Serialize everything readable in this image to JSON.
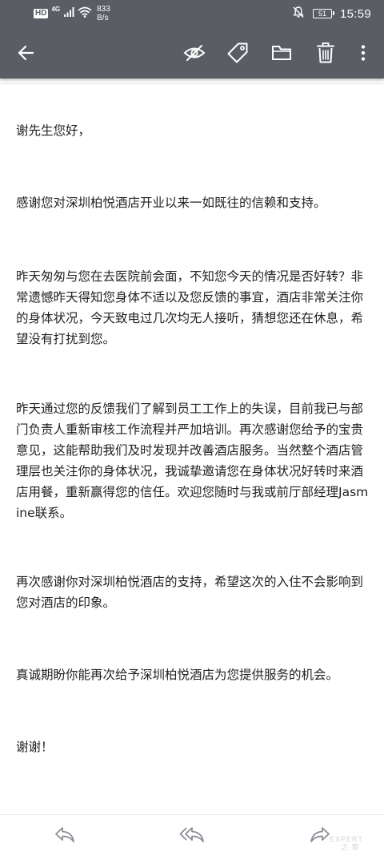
{
  "status_bar": {
    "hd": "HD",
    "network": "4G",
    "speed_value": "833",
    "speed_unit": "B/s",
    "battery": "51",
    "time": "15:59"
  },
  "toolbar": {
    "icons": [
      "back-arrow-icon",
      "eye-off-icon",
      "tag-icon",
      "folder-icon",
      "trash-icon",
      "more-vert-icon"
    ]
  },
  "email": {
    "paragraphs": [
      "谢先生您好，",
      "感谢您对深圳柏悦酒店开业以来一如既往的信赖和支持。",
      "昨天匆匆与您在去医院前会面，不知您今天的情况是否好转？非常遗憾昨天得知您身体不适以及您反馈的事宜，酒店非常关注你的身体状况，今天致电过几次均无人接听，猜想您还在休息，希望没有打扰到您。",
      "昨天通过您的反馈我们了解到员工工作上的失误，目前我已与部门负责人重新审核工作流程并严加培训。再次感谢您给予的宝贵意见，这能帮助我们及时发现并改善酒店服务。当然整个酒店管理层也关注你的身体状况，我诚挚邀请您在身体状况好转时来酒店用餐，重新赢得您的信任。欢迎您随时与我或前厅部经理Jasmine联系。",
      "再次感谢你对深圳柏悦酒店的支持，希望这次的入住不会影响到您对酒店的印象。",
      "真诚期盼你能再次给予深圳柏悦酒店为您提供服务的机会。",
      "谢谢！"
    ]
  },
  "bottom_bar": {
    "icons": [
      "reply-icon",
      "reply-all-icon",
      "forward-icon"
    ]
  },
  "colors": {
    "bar_bg": "#5a5d64",
    "bar_fg": "#ffffff",
    "text": "#222222",
    "bottom_icon": "#8a8f96"
  }
}
